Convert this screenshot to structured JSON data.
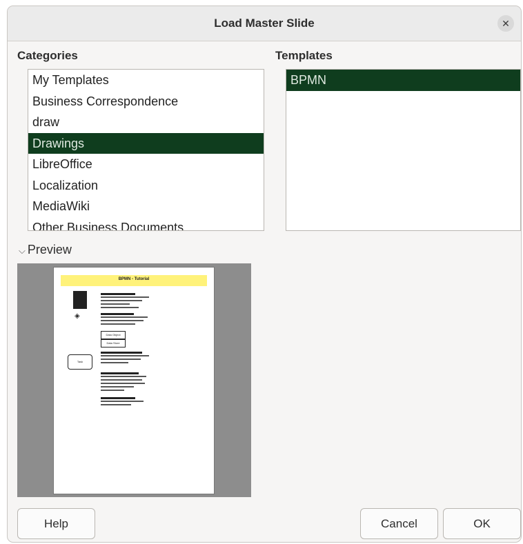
{
  "dialog": {
    "title": "Load Master Slide"
  },
  "categories": {
    "label": "Categories",
    "items": [
      {
        "label": "My Templates",
        "selected": false
      },
      {
        "label": "Business Correspondence",
        "selected": false
      },
      {
        "label": "draw",
        "selected": false
      },
      {
        "label": "Drawings",
        "selected": true
      },
      {
        "label": "LibreOffice",
        "selected": false
      },
      {
        "label": "Localization",
        "selected": false
      },
      {
        "label": "MediaWiki",
        "selected": false
      },
      {
        "label": "Other Business Documents",
        "selected": false
      }
    ]
  },
  "templates": {
    "label": "Templates",
    "items": [
      {
        "label": "BPMN",
        "selected": true
      }
    ]
  },
  "preview": {
    "label": "Preview",
    "expanded": true,
    "page_title": "BPMN - Tutorial",
    "box_labels": [
      "Data Object",
      "Data Store"
    ],
    "task_label": "Task"
  },
  "buttons": {
    "help": "Help",
    "cancel": "Cancel",
    "ok": "OK"
  },
  "colors": {
    "selection": "#0f3d1e",
    "header_highlight": "#fff27a",
    "preview_bg": "#8d8d8d"
  },
  "icons": {
    "close": "close-icon",
    "expander": "chevron-down-icon"
  }
}
